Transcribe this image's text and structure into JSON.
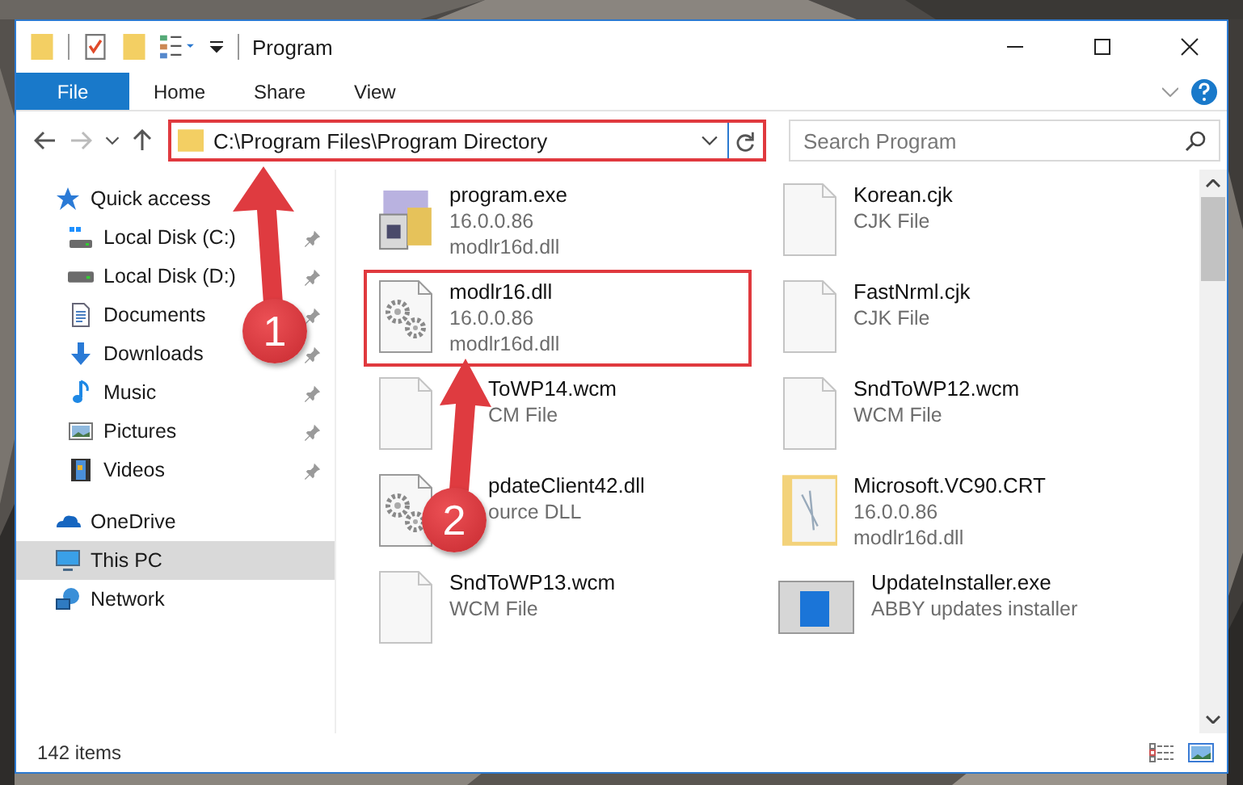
{
  "window": {
    "title": "Program"
  },
  "ribbon": {
    "file_button": "File",
    "tabs": [
      "Home",
      "Share",
      "View"
    ]
  },
  "address_bar": {
    "path": "C:\\Program Files\\Program Directory",
    "highlighted": true
  },
  "search": {
    "placeholder": "Search Program"
  },
  "sidebar": {
    "items": [
      {
        "label": "Quick access",
        "selected": false,
        "children": [
          {
            "label": "Local Disk (C:)",
            "pinned": true
          },
          {
            "label": "Local Disk (D:)",
            "pinned": true
          },
          {
            "label": "Documents",
            "pinned": true
          },
          {
            "label": "Downloads",
            "pinned": true
          },
          {
            "label": "Music",
            "pinned": true
          },
          {
            "label": "Pictures",
            "pinned": true
          },
          {
            "label": "Videos",
            "pinned": true
          }
        ]
      },
      {
        "label": "OneDrive",
        "selected": false
      },
      {
        "label": "This PC",
        "selected": true
      },
      {
        "label": "Network",
        "selected": false
      }
    ]
  },
  "files": [
    {
      "name": "program.exe",
      "details": [
        "16.0.0.86",
        "modlr16d.dll"
      ],
      "kind": "exe",
      "highlighted": false,
      "covered": false
    },
    {
      "name": "Korean.cjk",
      "details": [
        "CJK File"
      ],
      "kind": "file",
      "highlighted": false,
      "covered": false
    },
    {
      "name": "modlr16.dll",
      "details": [
        "16.0.0.86",
        "modlr16d.dll"
      ],
      "kind": "dll",
      "highlighted": true,
      "covered": false
    },
    {
      "name": "FastNrml.cjk",
      "details": [
        "CJK File"
      ],
      "kind": "file",
      "highlighted": false,
      "covered": false
    },
    {
      "name": "ToWP14.wcm",
      "details": [
        "CM File"
      ],
      "kind": "file",
      "highlighted": false,
      "covered": true
    },
    {
      "name": "SndToWP12.wcm",
      "details": [
        "WCM File"
      ],
      "kind": "file",
      "highlighted": false,
      "covered": false
    },
    {
      "name": "pdateClient42.dll",
      "details": [
        "ource DLL"
      ],
      "kind": "dll",
      "highlighted": false,
      "covered": true
    },
    {
      "name": "Microsoft.VC90.CRT",
      "details": [
        "16.0.0.86",
        "modlr16d.dll"
      ],
      "kind": "folder",
      "highlighted": false,
      "covered": false
    },
    {
      "name": "SndToWP13.wcm",
      "details": [
        "WCM File"
      ],
      "kind": "file",
      "highlighted": false,
      "covered": false
    },
    {
      "name": "UpdateInstaller.exe",
      "details": [
        "ABBY updates installer"
      ],
      "kind": "installer",
      "highlighted": false,
      "covered": false
    }
  ],
  "status_bar": {
    "item_count": "142 items"
  },
  "annotations": [
    {
      "number": "1"
    },
    {
      "number": "2"
    }
  ]
}
